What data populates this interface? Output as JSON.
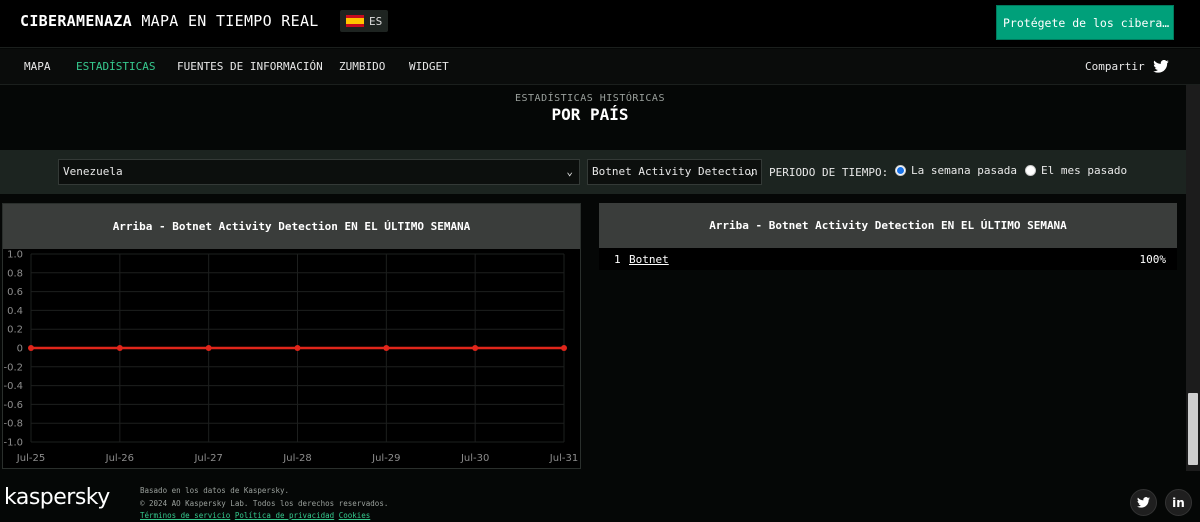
{
  "header": {
    "brand_bold": "CIBERAMENAZA",
    "brand_rest": " MAPA EN TIEMPO REAL",
    "lang_code": "ES",
    "lang_flag": "spain-flag-icon",
    "protect_button": "Protégete de los ciberataqu…"
  },
  "nav": {
    "items": [
      "MAPA",
      "ESTADÍSTICAS",
      "FUENTES DE INFORMACIÓN",
      "ZUMBIDO",
      "WIDGET"
    ],
    "active_index": 1,
    "share_label": "Compartir",
    "share_icon": "twitter-icon"
  },
  "section": {
    "subtitle": "ESTADÍSTICAS HISTÓRICAS",
    "title": "POR PAÍS"
  },
  "filters": {
    "country": "Venezuela",
    "detection": "Botnet Activity Detection",
    "period_label": "PERIODO DE TIEMPO:",
    "period_options": [
      "La semana pasada",
      "El mes pasado"
    ],
    "period_selected": 0
  },
  "line_panel": {
    "title": "Arriba - Botnet Activity Detection EN EL ÚLTIMO SEMANA"
  },
  "rank_panel": {
    "title": "Arriba - Botnet Activity Detection EN EL ÚLTIMO SEMANA",
    "rows": [
      {
        "rank": "1",
        "name": "Botnet",
        "value": "100%"
      }
    ]
  },
  "chart_data": {
    "type": "line",
    "categories": [
      "Jul-25",
      "Jul-26",
      "Jul-27",
      "Jul-28",
      "Jul-29",
      "Jul-30",
      "Jul-31"
    ],
    "series": [
      {
        "values": [
          0,
          0,
          0,
          0,
          0,
          0,
          0
        ],
        "color": "#e0261b"
      }
    ],
    "ylim": [
      -1.0,
      1.0
    ],
    "yticks": [
      "1.0",
      "0.8",
      "0.6",
      "0.4",
      "0.2",
      "0",
      "-0.2",
      "-0.4",
      "-0.6",
      "-0.8",
      "-1.0"
    ],
    "grid": true,
    "legend": "none"
  },
  "footer": {
    "logo": "kaspersky",
    "note1": "Basado en los datos de Kaspersky.",
    "note2": "© 2024 AO Kaspersky Lab. Todos los derechos reservados.",
    "links": [
      "Términos de servicio",
      "Política de privacidad",
      "Cookies"
    ],
    "social": [
      "twitter-icon",
      "linkedin-icon"
    ]
  },
  "colors": {
    "accent": "#36c98e",
    "button": "#00a07a",
    "series": "#e0261b"
  }
}
